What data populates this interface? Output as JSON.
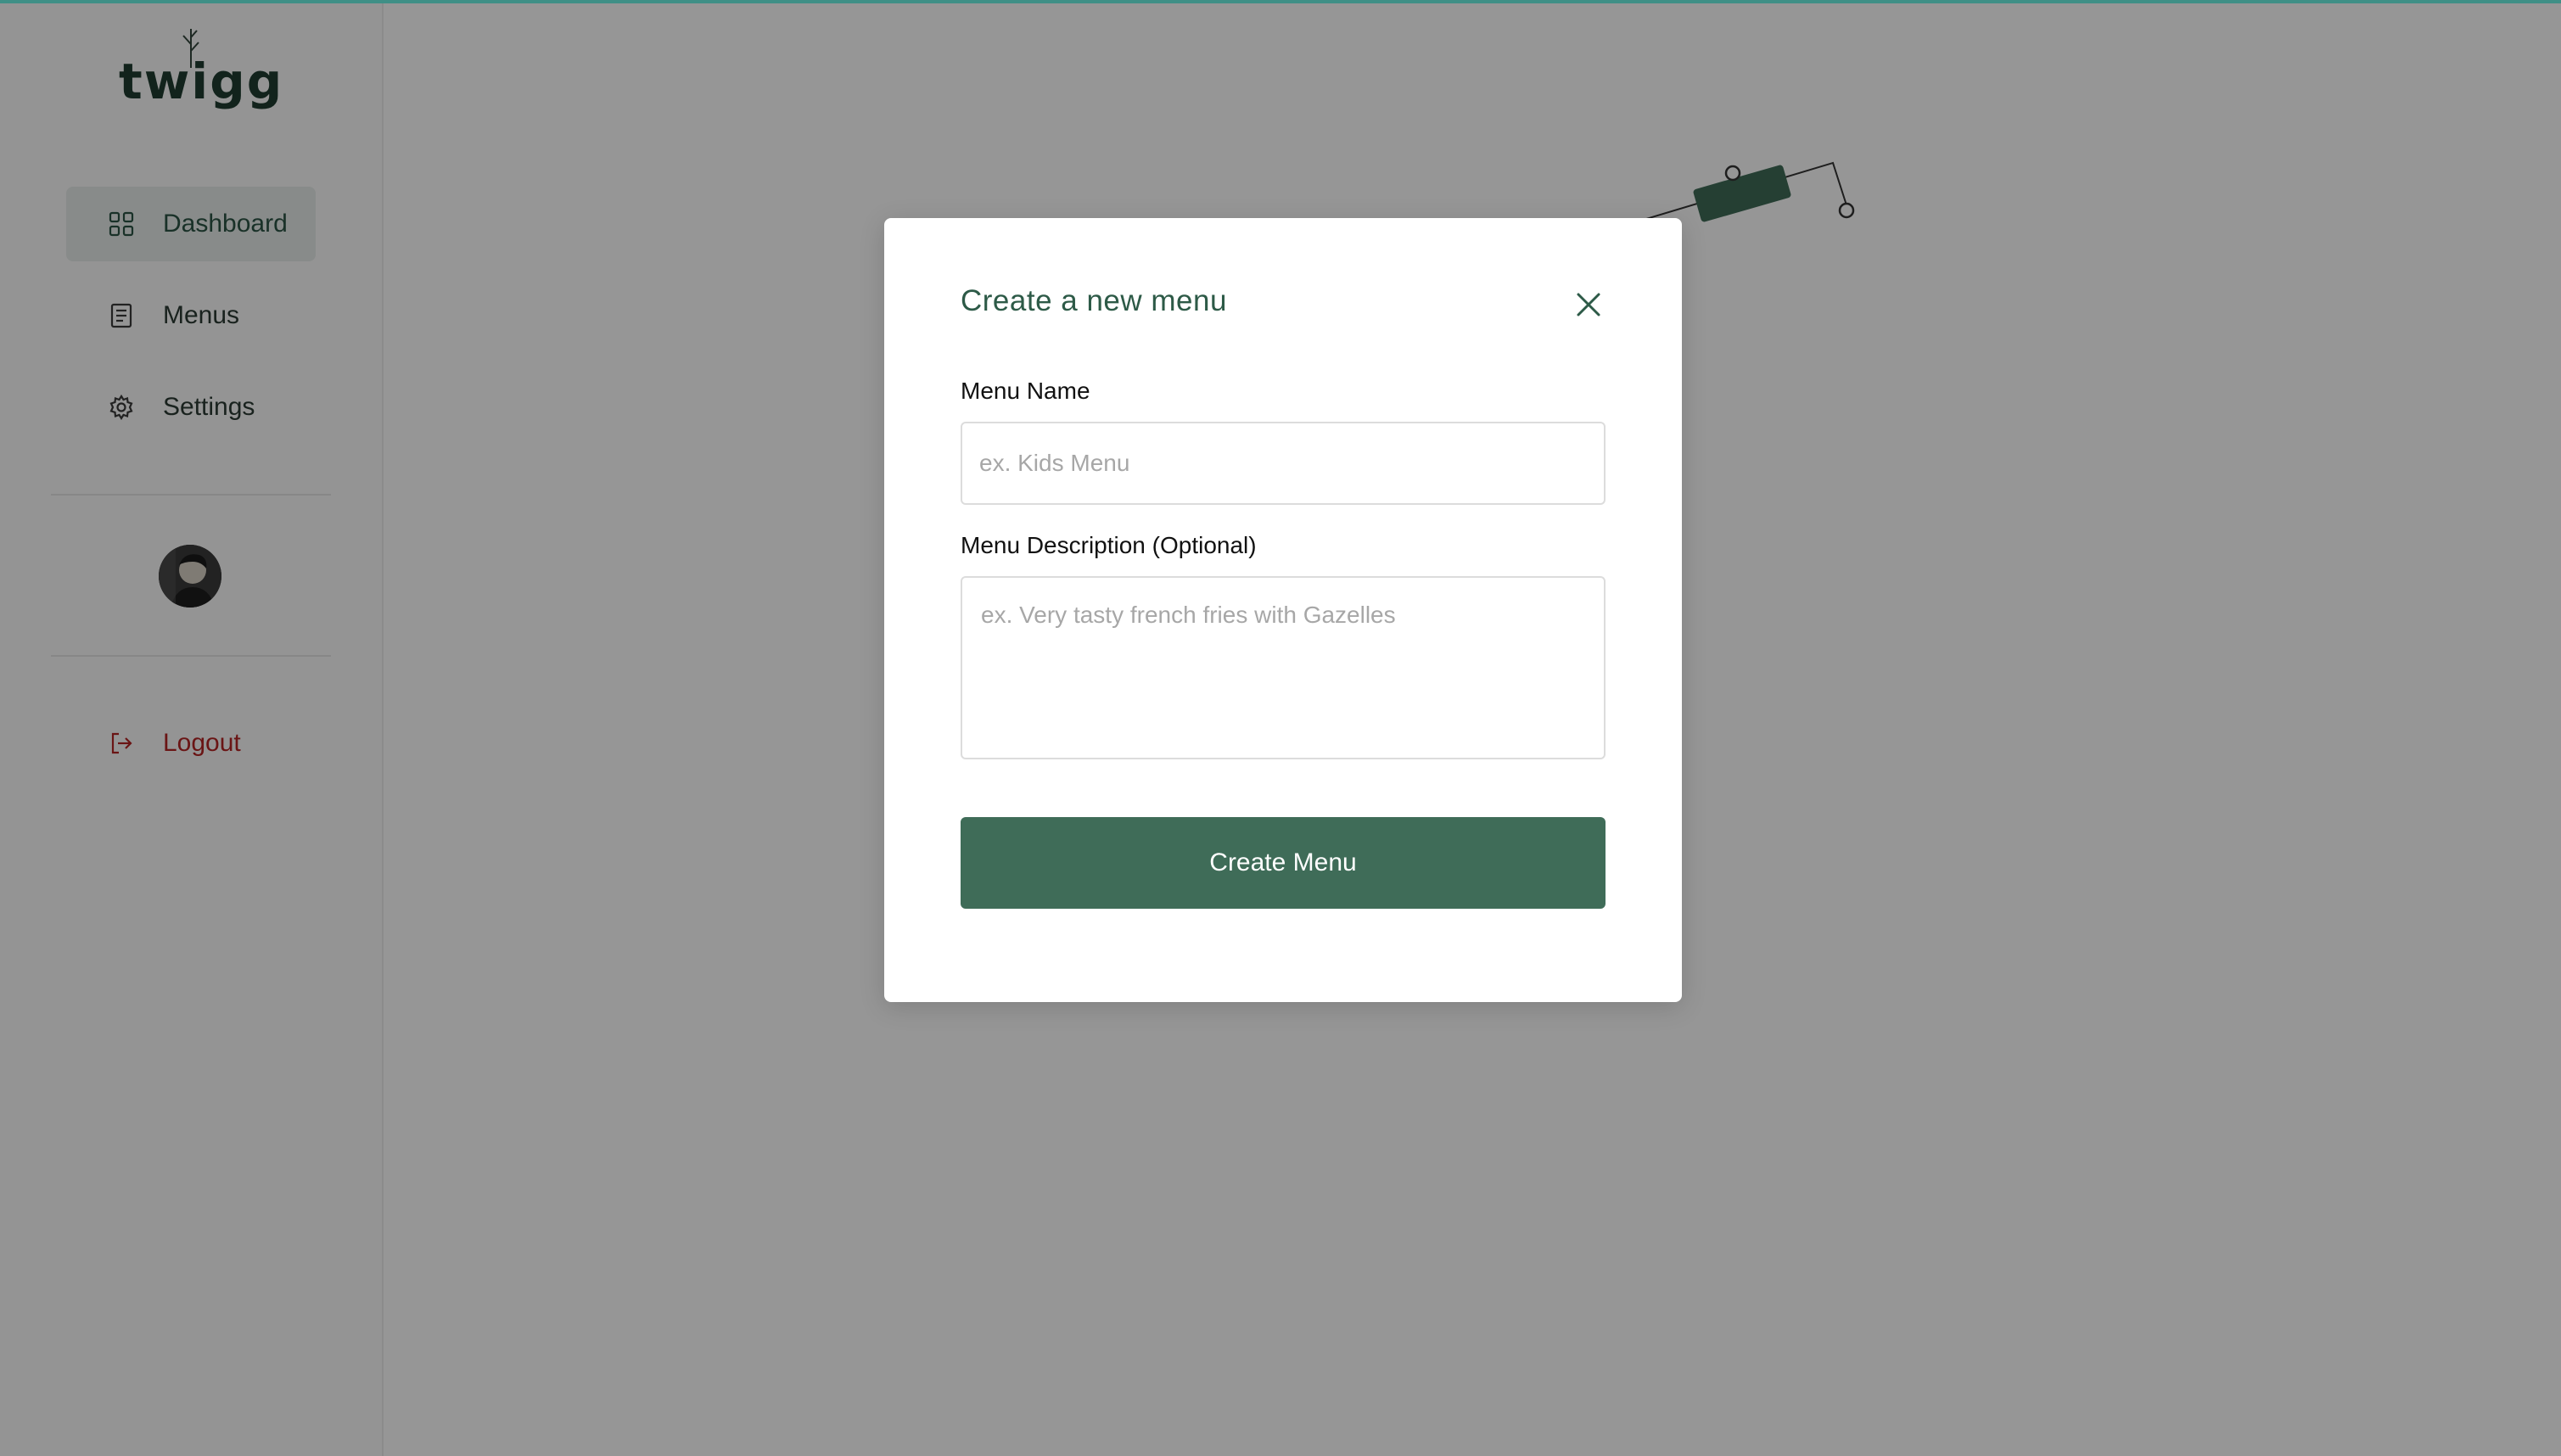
{
  "app": {
    "logo_text": "twigg"
  },
  "sidebar": {
    "items": [
      {
        "label": "Dashboard",
        "icon": "grid-icon",
        "active": true
      },
      {
        "label": "Menus",
        "icon": "document-icon"
      },
      {
        "label": "Settings",
        "icon": "gear-icon"
      }
    ],
    "logout_label": "Logout"
  },
  "modal": {
    "title": "Create a new menu",
    "menu_name_label": "Menu Name",
    "menu_name_placeholder": "ex. Kids Menu",
    "menu_name_value": "",
    "description_label": "Menu Description (Optional)",
    "description_placeholder": "ex. Very tasty french fries with Gazelles",
    "description_value": "",
    "submit_label": "Create Menu",
    "close_icon": "close-icon"
  },
  "colors": {
    "brand_green": "#3f6c58",
    "title_green": "#2d5a47",
    "logout_red": "#b52424",
    "top_accent": "#3f8f86"
  }
}
